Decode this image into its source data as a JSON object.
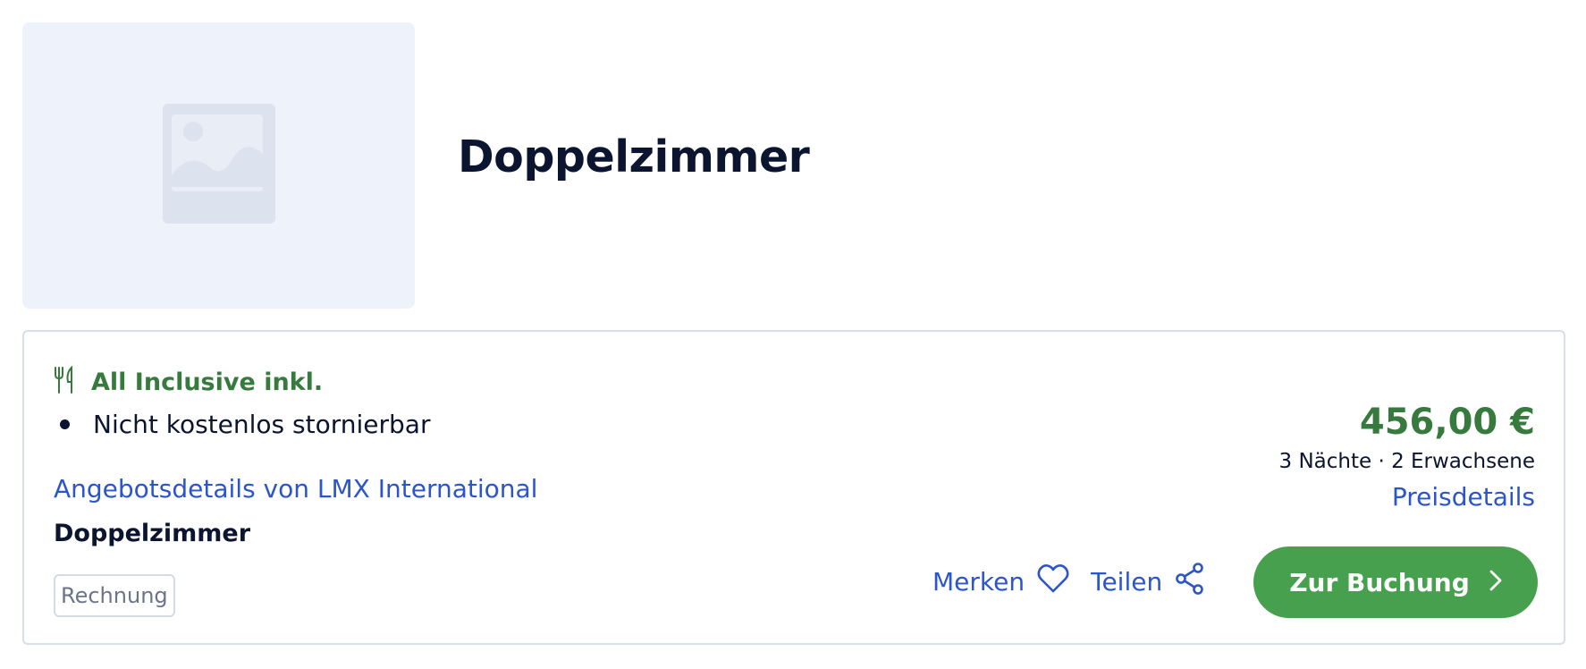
{
  "room": {
    "title": "Doppelzimmer",
    "image_icon": "image-placeholder-icon"
  },
  "offer": {
    "board_icon": "cutlery-icon",
    "board_label": "All Inclusive inkl.",
    "cancellation": "Nicht kostenlos stornierbar",
    "details_link": "Angebotsdetails von LMX International",
    "room_name": "Doppelzimmer",
    "payment_badge": "Rechnung"
  },
  "pricing": {
    "price": "456,00 €",
    "summary": "3 Nächte · 2 Erwachsene",
    "details_link": "Preisdetails"
  },
  "actions": {
    "save_label": "Merken",
    "save_icon": "heart-icon",
    "share_label": "Teilen",
    "share_icon": "share-icon",
    "book_label": "Zur Buchung",
    "book_icon": "chevron-right-icon"
  },
  "colors": {
    "accent_green": "#367a3e",
    "button_green": "#46a04d",
    "link_blue": "#2b55c8",
    "text_dark": "#0b1530",
    "placeholder_bg": "#eef3fb"
  }
}
